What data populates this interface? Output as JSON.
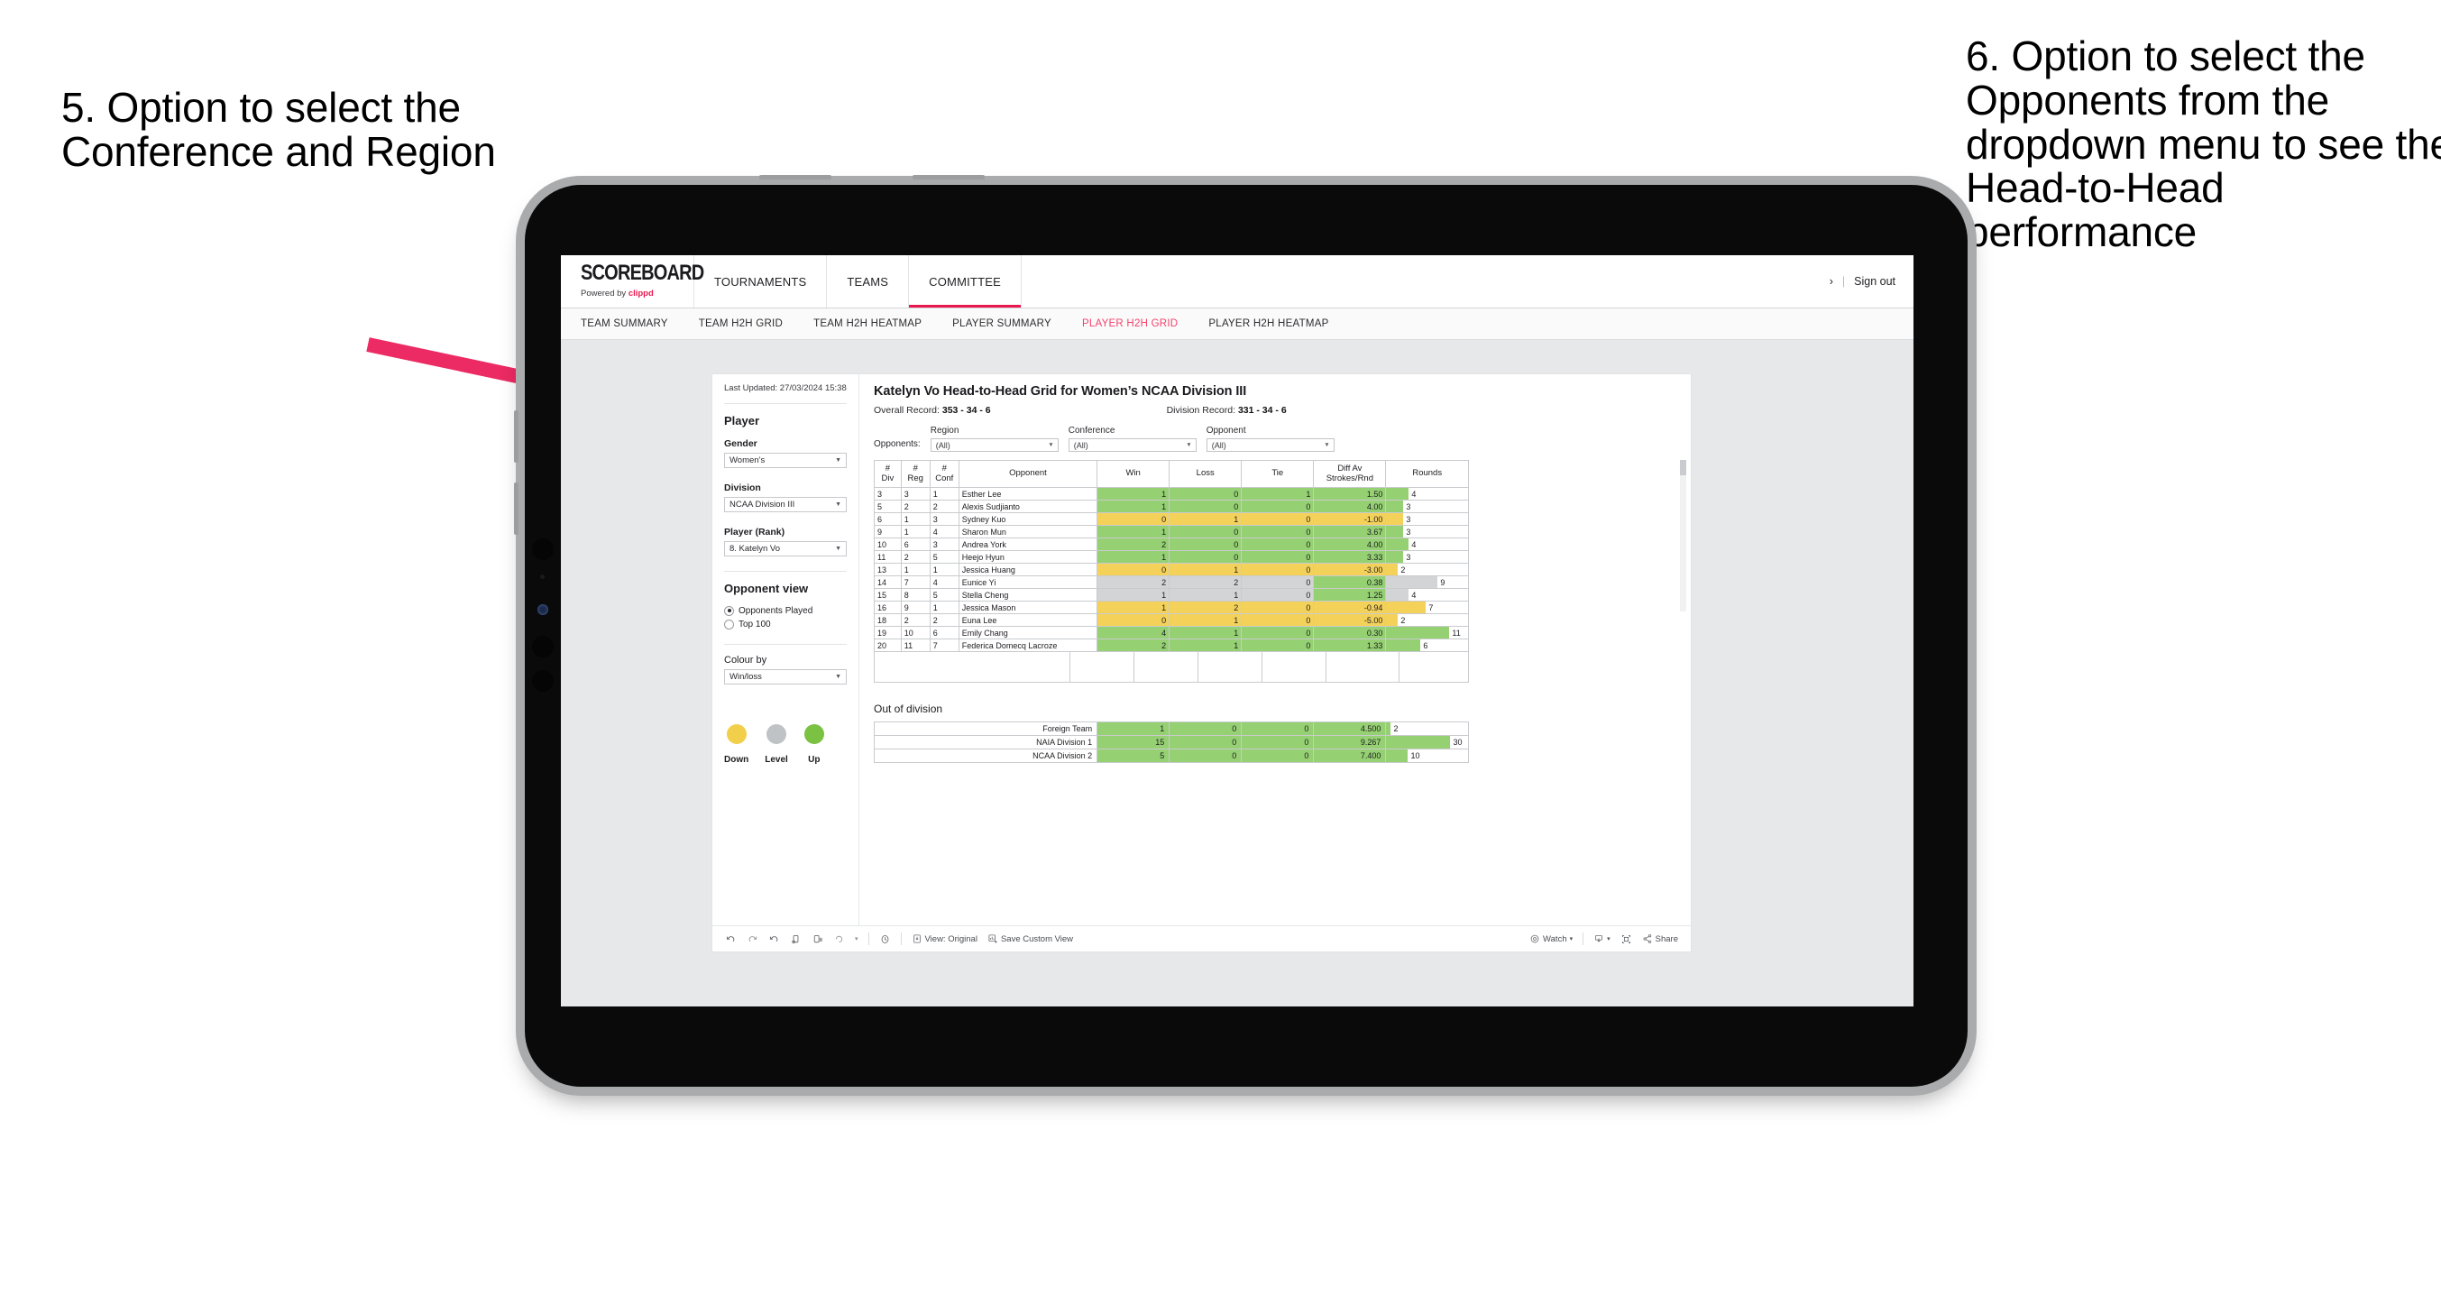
{
  "annotations": {
    "left": "5. Option to select the Conference and Region",
    "right": "6. Option to select the Opponents from the dropdown menu to see the Head-to-Head performance",
    "arrow_color": "#EC2A63"
  },
  "app": {
    "brand": {
      "title": "SCOREBOARD",
      "powered_prefix": "Powered by ",
      "powered_brand": "clippd"
    },
    "topnav": [
      {
        "label": "TOURNAMENTS",
        "active": false
      },
      {
        "label": "TEAMS",
        "active": false
      },
      {
        "label": "COMMITTEE",
        "active": true
      }
    ],
    "topnav_right": {
      "chevron": "›",
      "separator": "|",
      "sign_out": "Sign out"
    },
    "subnav": [
      {
        "label": "TEAM SUMMARY",
        "active": false
      },
      {
        "label": "TEAM H2H GRID",
        "active": false
      },
      {
        "label": "TEAM H2H HEATMAP",
        "active": false
      },
      {
        "label": "PLAYER SUMMARY",
        "active": false
      },
      {
        "label": "PLAYER H2H GRID",
        "active": true
      },
      {
        "label": "PLAYER H2H HEATMAP",
        "active": false
      }
    ]
  },
  "filters": {
    "last_updated": "Last Updated: 27/03/2024 15:38",
    "player_section": "Player",
    "gender": {
      "label": "Gender",
      "value": "Women’s"
    },
    "division": {
      "label": "Division",
      "value": "NCAA Division III"
    },
    "player_rank": {
      "label": "Player (Rank)",
      "value": "8. Katelyn Vo"
    },
    "opponent_view": {
      "title": "Opponent view",
      "options": [
        {
          "label": "Opponents Played",
          "selected": true
        },
        {
          "label": "Top 100",
          "selected": false
        }
      ]
    },
    "colour_by": {
      "label": "Colour by",
      "value": "Win/loss"
    },
    "legend": [
      {
        "label": "Down",
        "color": "#F2CF4A"
      },
      {
        "label": "Level",
        "color": "#BFC3C6"
      },
      {
        "label": "Up",
        "color": "#7BC142"
      }
    ]
  },
  "viz": {
    "title": "Katelyn Vo Head-to-Head Grid for Women’s NCAA Division III",
    "overall_record_label": "Overall Record:",
    "overall_record_value": "353 - 34 - 6",
    "division_record_label": "Division Record:",
    "division_record_value": "331 - 34 - 6",
    "opponents_label": "Opponents:",
    "dropdowns": [
      {
        "label": "Region",
        "value": "(All)"
      },
      {
        "label": "Conference",
        "value": "(All)"
      },
      {
        "label": "Opponent",
        "value": "(All)"
      }
    ]
  },
  "chart_data": {
    "type": "table",
    "title": "Katelyn Vo Head-to-Head Grid for Women’s NCAA Division III",
    "columns": [
      "# Div",
      "# Reg",
      "# Conf",
      "Opponent",
      "Win",
      "Loss",
      "Tie",
      "Diff Av Strokes/Rnd",
      "Rounds"
    ],
    "column_headers_two_line": [
      {
        "l1": "#",
        "l2": "Div"
      },
      {
        "l1": "#",
        "l2": "Reg"
      },
      {
        "l1": "#",
        "l2": "Conf"
      },
      {
        "l1": "Opponent",
        "l2": ""
      },
      {
        "l1": "Win",
        "l2": ""
      },
      {
        "l1": "Loss",
        "l2": ""
      },
      {
        "l1": "Tie",
        "l2": ""
      },
      {
        "l1": "Diff Av",
        "l2": "Strokes/Rnd"
      },
      {
        "l1": "Rounds",
        "l2": ""
      }
    ],
    "rounds_max": 12,
    "rows": [
      {
        "div": "3",
        "reg": "3",
        "conf": "1",
        "opponent": "Esther Lee",
        "win": "1",
        "loss": "0",
        "tie": "1",
        "diff": "1.50",
        "rounds": "4",
        "color": "green"
      },
      {
        "div": "5",
        "reg": "2",
        "conf": "2",
        "opponent": "Alexis Sudjianto",
        "win": "1",
        "loss": "0",
        "tie": "0",
        "diff": "4.00",
        "rounds": "3",
        "color": "green"
      },
      {
        "div": "6",
        "reg": "1",
        "conf": "3",
        "opponent": "Sydney Kuo",
        "win": "0",
        "loss": "1",
        "tie": "0",
        "diff": "-1.00",
        "rounds": "3",
        "color": "yellow"
      },
      {
        "div": "9",
        "reg": "1",
        "conf": "4",
        "opponent": "Sharon Mun",
        "win": "1",
        "loss": "0",
        "tie": "0",
        "diff": "3.67",
        "rounds": "3",
        "color": "green"
      },
      {
        "div": "10",
        "reg": "6",
        "conf": "3",
        "opponent": "Andrea York",
        "win": "2",
        "loss": "0",
        "tie": "0",
        "diff": "4.00",
        "rounds": "4",
        "color": "green"
      },
      {
        "div": "11",
        "reg": "2",
        "conf": "5",
        "opponent": "Heejo Hyun",
        "win": "1",
        "loss": "0",
        "tie": "0",
        "diff": "3.33",
        "rounds": "3",
        "color": "green"
      },
      {
        "div": "13",
        "reg": "1",
        "conf": "1",
        "opponent": "Jessica Huang",
        "win": "0",
        "loss": "1",
        "tie": "0",
        "diff": "-3.00",
        "rounds": "2",
        "color": "yellow"
      },
      {
        "div": "14",
        "reg": "7",
        "conf": "4",
        "opponent": "Eunice Yi",
        "win": "2",
        "loss": "2",
        "tie": "0",
        "diff": "0.38",
        "rounds": "9",
        "color": "grey",
        "diff_color": "green"
      },
      {
        "div": "15",
        "reg": "8",
        "conf": "5",
        "opponent": "Stella Cheng",
        "win": "1",
        "loss": "1",
        "tie": "0",
        "diff": "1.25",
        "rounds": "4",
        "color": "grey",
        "diff_color": "green"
      },
      {
        "div": "16",
        "reg": "9",
        "conf": "1",
        "opponent": "Jessica Mason",
        "win": "1",
        "loss": "2",
        "tie": "0",
        "diff": "-0.94",
        "rounds": "7",
        "color": "yellow"
      },
      {
        "div": "18",
        "reg": "2",
        "conf": "2",
        "opponent": "Euna Lee",
        "win": "0",
        "loss": "1",
        "tie": "0",
        "diff": "-5.00",
        "rounds": "2",
        "color": "yellow"
      },
      {
        "div": "19",
        "reg": "10",
        "conf": "6",
        "opponent": "Emily Chang",
        "win": "4",
        "loss": "1",
        "tie": "0",
        "diff": "0.30",
        "rounds": "11",
        "color": "green"
      },
      {
        "div": "20",
        "reg": "11",
        "conf": "7",
        "opponent": "Federica Domecq Lacroze",
        "win": "2",
        "loss": "1",
        "tie": "0",
        "diff": "1.33",
        "rounds": "6",
        "color": "green"
      }
    ]
  },
  "out_of_division": {
    "title": "Out of division",
    "rounds_max": 32,
    "rows": [
      {
        "name": "Foreign Team",
        "win": "1",
        "loss": "0",
        "tie": "0",
        "diff": "4.500",
        "rounds": "2",
        "color": "green"
      },
      {
        "name": "NAIA Division 1",
        "win": "15",
        "loss": "0",
        "tie": "0",
        "diff": "9.267",
        "rounds": "30",
        "color": "green"
      },
      {
        "name": "NCAA Division 2",
        "win": "5",
        "loss": "0",
        "tie": "0",
        "diff": "7.400",
        "rounds": "10",
        "color": "green"
      }
    ]
  },
  "toolbar": {
    "view_label": "View: Original",
    "save_label": "Save Custom View",
    "watch_label": "Watch",
    "share_label": "Share",
    "caret": "▾"
  }
}
